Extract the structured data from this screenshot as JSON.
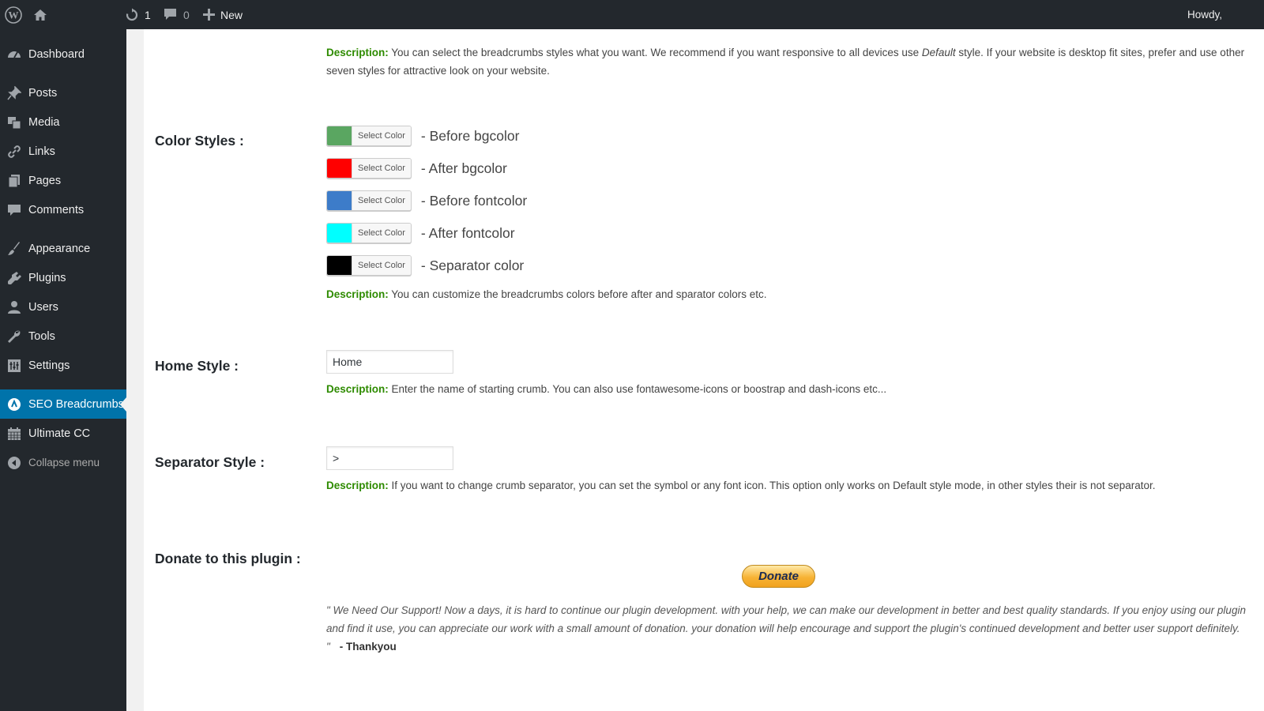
{
  "adminbar": {
    "updates_count": "1",
    "comments_count": "0",
    "new_label": "New",
    "howdy": "Howdy,"
  },
  "sidebar": {
    "items": [
      {
        "label": "Dashboard",
        "icon": "dashboard-icon"
      },
      {
        "label": "Posts",
        "icon": "pin-icon"
      },
      {
        "label": "Media",
        "icon": "media-icon"
      },
      {
        "label": "Links",
        "icon": "link-icon"
      },
      {
        "label": "Pages",
        "icon": "pages-icon"
      },
      {
        "label": "Comments",
        "icon": "comment-icon"
      },
      {
        "label": "Appearance",
        "icon": "brush-icon"
      },
      {
        "label": "Plugins",
        "icon": "plugin-icon"
      },
      {
        "label": "Users",
        "icon": "user-icon"
      },
      {
        "label": "Tools",
        "icon": "wrench-icon"
      },
      {
        "label": "Settings",
        "icon": "settings-icon"
      },
      {
        "label": "SEO Breadcrumbs",
        "icon": "breadcrumbs-icon",
        "active": true
      },
      {
        "label": "Ultimate CC",
        "icon": "calendar-icon"
      },
      {
        "label": "Collapse menu",
        "icon": "collapse-icon"
      }
    ]
  },
  "main": {
    "styles_desc": {
      "label": "Description:",
      "text_before": " You can select the breadcrumbs styles what you want. We recommend if you want responsive to all devices use ",
      "emphasis": "Default",
      "text_after": " style. If your website is desktop fit sites, prefer and use other seven styles for attractive look on your website."
    },
    "color_styles": {
      "label": "Color Styles :",
      "button_label": "Select Color",
      "pickers": [
        {
          "name": "- Before bgcolor",
          "color": "#5aa661"
        },
        {
          "name": "- After bgcolor",
          "color": "#ff0000"
        },
        {
          "name": "- Before fontcolor",
          "color": "#3d7cc9"
        },
        {
          "name": "- After fontcolor",
          "color": "#00ffff"
        },
        {
          "name": "- Separator color",
          "color": "#000000"
        }
      ],
      "desc_label": "Description:",
      "desc_text": " You can customize the breadcrumbs colors before after and sparator colors etc."
    },
    "home_style": {
      "label": "Home Style :",
      "value": "Home",
      "desc_label": "Description:",
      "desc_text": " Enter the name of starting crumb. You can also use fontawesome-icons or boostrap and dash-icons etc..."
    },
    "separator_style": {
      "label": "Separator Style :",
      "value": ">",
      "desc_label": "Description:",
      "desc_text": " If you want to change crumb separator, you can set the symbol or any font icon. This option only works on Default style mode, in other styles their is not separator."
    },
    "donate": {
      "label": "Donate to this plugin :",
      "button_label": "Donate",
      "quote": "\" We Need Our Support! Now a days, it is hard to continue our plugin development. with your help, we can make our development in better and best quality standards. If you enjoy using our plugin and find it use, you can appreciate our work with a small amount of donation. your donation will help encourage and support the plugin's continued development and better user support definitely. \"",
      "thanks": "- Thankyou"
    }
  },
  "colors": {
    "sidebar_bg": "#23282d",
    "active_item": "#0073aa",
    "description_label": "#2e8b00"
  }
}
